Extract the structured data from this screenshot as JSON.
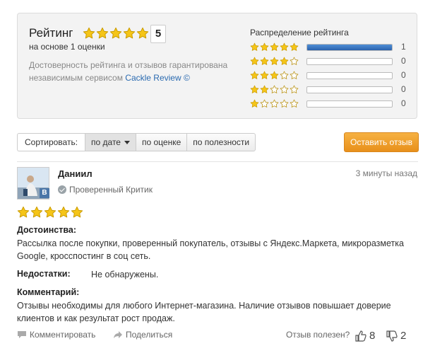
{
  "summary": {
    "title": "Рейтинг",
    "rating": 5,
    "score": "5",
    "based_on": "на основе 1 оценки",
    "guarantee_text": "Достоверность рейтинга и отзывов гарантирована независимым сервисом ",
    "guarantee_link": "Cackle Review ©",
    "distribution_title": "Распределение рейтинга",
    "distribution": [
      {
        "stars": 5,
        "fraction": 1.0,
        "count": "1"
      },
      {
        "stars": 4,
        "fraction": 0,
        "count": "0"
      },
      {
        "stars": 3,
        "fraction": 0,
        "count": "0"
      },
      {
        "stars": 2,
        "fraction": 0,
        "count": "0"
      },
      {
        "stars": 1,
        "fraction": 0,
        "count": "0"
      }
    ]
  },
  "sort": {
    "label": "Сортировать:",
    "by_date": "по дате",
    "by_rating": "по оценке",
    "by_usefulness": "по полезности"
  },
  "write_review_label": "Оставить отзыв",
  "review": {
    "author": "Даниил",
    "time": "3 минуты назад",
    "badge": "B",
    "verified": "Проверенный Критик",
    "rating": 5,
    "pros_label": "Достоинства:",
    "pros": "Рассылка после покупки, проверенный покупатель, отзывы с Яндекс.Маркета, микроразметка Google, кросспостинг в соц сеть.",
    "cons_label": "Недостатки:",
    "cons": "Не обнаружены.",
    "comment_label": "Комментарий:",
    "comment": "Отзывы необходимы для любого Интернет-магазина. Наличие отзывов повышает доверие клиентов и как результат рост продаж.",
    "comment_action": "Комментировать",
    "share_action": "Поделиться",
    "useful_question": "Отзыв полезен?",
    "up_votes": "8",
    "down_votes": "2"
  },
  "colors": {
    "star_filled": "#f5c518",
    "star_empty": "#ffffff",
    "accent_blue": "#2a62ad",
    "orange": "#e8901b"
  }
}
